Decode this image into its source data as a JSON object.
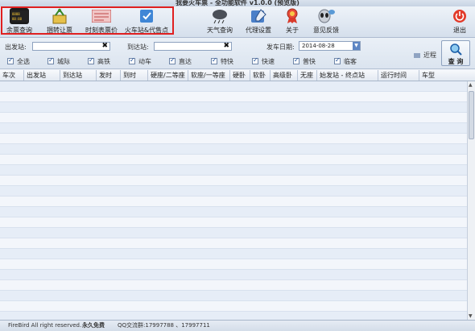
{
  "window": {
    "title": "我要火车票 - 全功能软件 v1.0.0 (预览版)"
  },
  "toolbar": {
    "items": [
      {
        "label": "余票查询",
        "icon": "ticket-board-icon"
      },
      {
        "label": "捆转让票",
        "icon": "ticket-transfer-icon"
      },
      {
        "label": "时刻表票价",
        "icon": "timetable-icon"
      },
      {
        "label": "火车站&代售点",
        "icon": "station-map-icon"
      },
      {
        "label": "天气查询",
        "icon": "weather-icon"
      },
      {
        "label": "代理设置",
        "icon": "proxy-settings-icon"
      },
      {
        "label": "关于",
        "icon": "award-icon"
      },
      {
        "label": "意见反馈",
        "icon": "alien-feedback-icon"
      },
      {
        "label": "退出",
        "icon": "power-icon"
      }
    ]
  },
  "search": {
    "from_label": "出发站:",
    "from_value": "",
    "to_label": "到达站:",
    "to_value": "",
    "date_label": "发车日期:",
    "date_value": "2014-08-28",
    "nearby_label": "近程",
    "query_label": "查 询"
  },
  "filters": [
    {
      "label": "全选",
      "checked": true
    },
    {
      "label": "城际",
      "checked": true
    },
    {
      "label": "高铁",
      "checked": true
    },
    {
      "label": "动车",
      "checked": true
    },
    {
      "label": "直达",
      "checked": true
    },
    {
      "label": "特快",
      "checked": true
    },
    {
      "label": "快速",
      "checked": true
    },
    {
      "label": "普快",
      "checked": true
    },
    {
      "label": "临客",
      "checked": true
    }
  ],
  "table": {
    "columns": [
      "车次",
      "出发站",
      "到达站",
      "发时",
      "到时",
      "硬座/二等座",
      "软座/一等座",
      "硬卧",
      "软卧",
      "高级卧",
      "无座",
      "始发站 - 终点站",
      "运行时间",
      "车型"
    ]
  },
  "status": {
    "copyright": "FireBird All right reserved.",
    "free": "永久免费",
    "qq": "QQ交流群:17997788 、17997711"
  },
  "colors": {
    "highlight_box": "#e02020",
    "row_alt": "#e6edf7"
  }
}
